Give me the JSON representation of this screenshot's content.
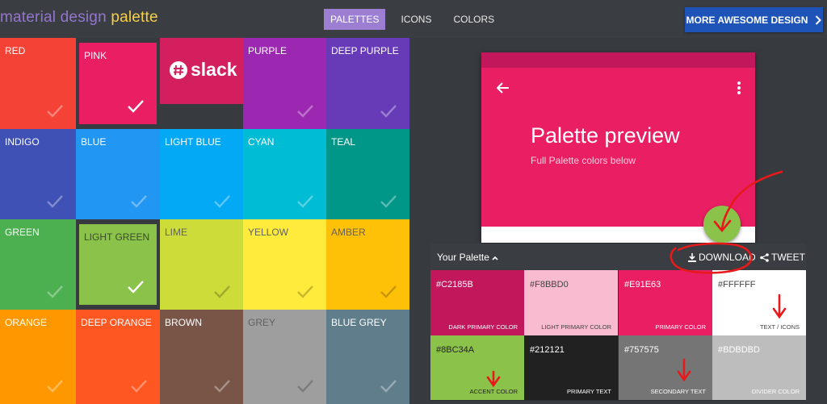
{
  "header": {
    "brand_part1": "material design",
    "brand_part2": " palette",
    "nav": [
      {
        "label": "PALETTES",
        "active": true
      },
      {
        "label": "ICONS",
        "active": false
      },
      {
        "label": "COLORS",
        "active": false
      }
    ],
    "cta_label": "MORE AWESOME DESIGN",
    "cta_icon": "chevron-right-icon"
  },
  "colors": [
    {
      "name": "RED",
      "hex": "#f44336"
    },
    {
      "name": "PINK",
      "hex": "#e91e63",
      "selected": true
    },
    {
      "name": "slack",
      "hex": "#d41f5f",
      "sponsor": true
    },
    {
      "name": "PURPLE",
      "hex": "#9c27b0"
    },
    {
      "name": "DEEP PURPLE",
      "hex": "#673ab7"
    },
    {
      "name": "INDIGO",
      "hex": "#3f51b5"
    },
    {
      "name": "BLUE",
      "hex": "#2196f3"
    },
    {
      "name": "LIGHT BLUE",
      "hex": "#03a9f4"
    },
    {
      "name": "CYAN",
      "hex": "#00bcd4"
    },
    {
      "name": "TEAL",
      "hex": "#009688"
    },
    {
      "name": "GREEN",
      "hex": "#4caf50"
    },
    {
      "name": "LIGHT GREEN",
      "hex": "#8bc34a",
      "selected": true
    },
    {
      "name": "LIME",
      "hex": "#cddc39"
    },
    {
      "name": "YELLOW",
      "hex": "#ffeb3b"
    },
    {
      "name": "AMBER",
      "hex": "#ffc107"
    },
    {
      "name": "ORANGE",
      "hex": "#ff9800"
    },
    {
      "name": "DEEP ORANGE",
      "hex": "#ff5722"
    },
    {
      "name": "BROWN",
      "hex": "#795548"
    },
    {
      "name": "GREY",
      "hex": "#9e9e9e"
    },
    {
      "name": "BLUE GREY",
      "hex": "#607d8b"
    }
  ],
  "preview": {
    "title": "Palette preview",
    "subtitle": "Full Palette colors below",
    "back_icon": "arrow-left-icon",
    "menu_icon": "more-vert-icon"
  },
  "palette_bar": {
    "label": "Your Palette",
    "label_icon": "chevron-up-icon",
    "download_label": "DOWNLOAD",
    "download_icon": "download-icon",
    "tweet_label": "TWEET",
    "tweet_icon": "share-icon"
  },
  "swatches": [
    {
      "hex": "#C2185B",
      "role": "DARK PRIMARY COLOR",
      "bg": "#c2185b",
      "fg": "#ffffff"
    },
    {
      "hex": "#F8BBD0",
      "role": "LIGHT PRIMARY COLOR",
      "bg": "#f8bbd0",
      "fg": "#424242"
    },
    {
      "hex": "#E91E63",
      "role": "PRIMARY COLOR",
      "bg": "#e91e63",
      "fg": "#ffffff"
    },
    {
      "hex": "#FFFFFF",
      "role": "TEXT / ICONS",
      "bg": "#ffffff",
      "fg": "#424242"
    },
    {
      "hex": "#8BC34A",
      "role": "ACCENT COLOR",
      "bg": "#8bc34a",
      "fg": "#212121"
    },
    {
      "hex": "#212121",
      "role": "PRIMARY TEXT",
      "bg": "#212121",
      "fg": "#ffffff"
    },
    {
      "hex": "#757575",
      "role": "SECONDARY TEXT",
      "bg": "#757575",
      "fg": "#ffffff"
    },
    {
      "hex": "#BDBDBD",
      "role": "DIVIDER COLOR",
      "bg": "#bdbdbd",
      "fg": "#ffffff"
    }
  ],
  "theme": {
    "header_bg": "#3a3e43",
    "panel_bg": "#373b40",
    "accent_purple": "#9c7fd3",
    "cta_blue": "#1e54b7",
    "annotation_red": "#e8191b"
  }
}
